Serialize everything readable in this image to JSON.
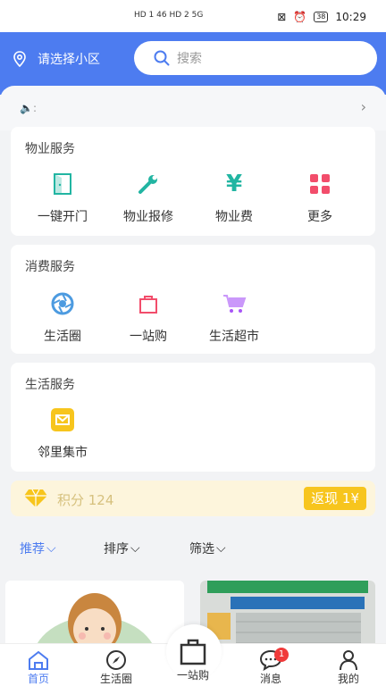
{
  "status": {
    "signal_left": "HD 1  46  HD 2  5G",
    "time": "10:29",
    "battery": "38"
  },
  "header": {
    "location": "请选择小区",
    "search_placeholder": "搜索"
  },
  "notice": {
    "text": ":"
  },
  "property": {
    "title": "物业服务",
    "items": [
      {
        "label": "一键开门",
        "icon": "door-icon"
      },
      {
        "label": "物业报修",
        "icon": "wrench-icon"
      },
      {
        "label": "物业费",
        "icon": "yen-icon"
      },
      {
        "label": "更多",
        "icon": "grid-icon"
      }
    ]
  },
  "consume": {
    "title": "消费服务",
    "items": [
      {
        "label": "生活圈",
        "icon": "aperture-icon"
      },
      {
        "label": "一站购",
        "icon": "bag-icon"
      },
      {
        "label": "生活超市",
        "icon": "cart-icon"
      }
    ]
  },
  "life": {
    "title": "生活服务",
    "items": [
      {
        "label": "邻里集市",
        "icon": "mail-icon"
      }
    ]
  },
  "points": {
    "label": "积分 124",
    "cashback": "返现 1¥"
  },
  "filters": [
    {
      "label": "推荐"
    },
    {
      "label": "排序"
    },
    {
      "label": "筛选"
    }
  ],
  "tabs": [
    {
      "label": "首页"
    },
    {
      "label": "生活圈"
    },
    {
      "label": "一站购"
    },
    {
      "label": "消息"
    },
    {
      "label": "我的"
    }
  ],
  "message_badge": "1",
  "colors": {
    "primary": "#4d7cf0",
    "teal": "#22b5a2",
    "pink": "#f24d6b",
    "yellow": "#f7c51d",
    "purple": "#a855f7"
  }
}
